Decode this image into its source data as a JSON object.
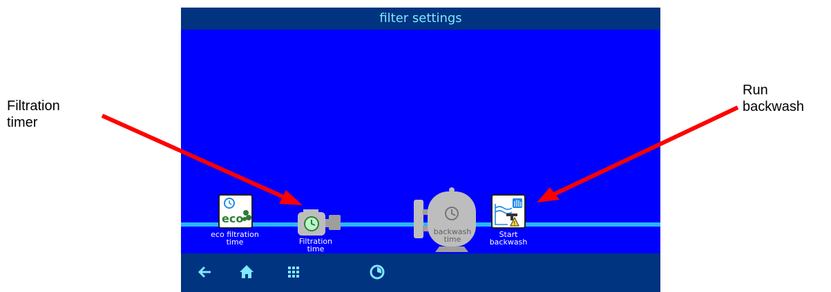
{
  "screen": {
    "title": "filter settings",
    "tiles": [
      {
        "label_line1": "eco filtration",
        "label_line2": "time",
        "icon": "eco-timer-icon",
        "badge": "eco"
      },
      {
        "label_line1": "Filtration",
        "label_line2": "time",
        "icon": "pump-timer-icon"
      },
      {
        "label_line1": "backwash",
        "label_line2": "time",
        "icon": "filter-tank-icon"
      },
      {
        "label_line1": "Start",
        "label_line2": "backwash",
        "icon": "hand-valve-icon"
      }
    ],
    "nav": [
      {
        "icon": "back-arrow-icon"
      },
      {
        "icon": "home-icon"
      },
      {
        "icon": "grid-menu-icon"
      },
      {
        "icon": "timer-status-icon"
      }
    ]
  },
  "annotations": {
    "left": {
      "line1": "Filtration",
      "line2": "timer"
    },
    "right": {
      "line1": "Run",
      "line2": "backwash"
    },
    "arrow_color": "#ff0000"
  },
  "colors": {
    "background": "#0000ff",
    "bar": "#003380",
    "title_text": "#7fe8ff",
    "pipe": "#29b6ff"
  }
}
